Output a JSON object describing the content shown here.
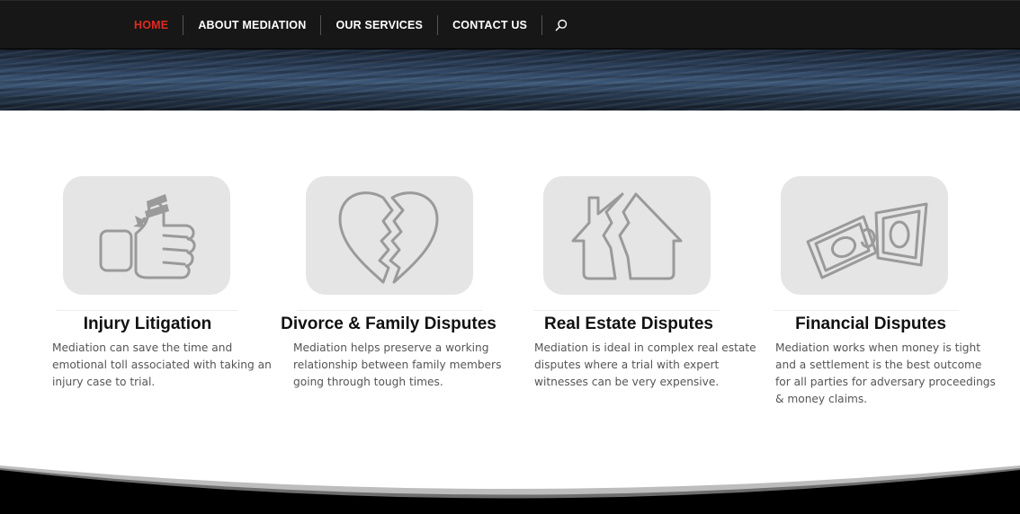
{
  "nav": {
    "items": [
      {
        "label": "HOME",
        "active": true
      },
      {
        "label": "ABOUT MEDIATION",
        "active": false
      },
      {
        "label": "OUR SERVICES",
        "active": false
      },
      {
        "label": "CONTACT US",
        "active": false
      }
    ],
    "search_icon": "search-icon",
    "active_color": "#e02b20"
  },
  "colors": {
    "nav_bg": "#171717",
    "card_bg": "#e5e5e5",
    "icon_stroke": "#9a9a9a",
    "title": "#111111",
    "body_text": "#555555"
  },
  "services": [
    {
      "icon": "bandaged-thumbs-up-icon",
      "title": "Injury Litigation",
      "lines": [
        "Mediation can save the time and",
        "emotional toll associated with taking an",
        "injury case to trial."
      ]
    },
    {
      "icon": "broken-heart-icon",
      "title": "Divorce & Family Disputes",
      "lines": [
        "Mediation helps preserve a working",
        "relationship between family members",
        "going through tough times."
      ]
    },
    {
      "icon": "cracked-house-icon",
      "title": "Real Estate Disputes",
      "lines": [
        "Mediation is ideal in complex real estate",
        "disputes where a trial with expert",
        "witnesses can be very expensive."
      ]
    },
    {
      "icon": "money-bills-icon",
      "title": "Financial Disputes",
      "lines": [
        "Mediation works when money is tight",
        "and a settlement is the best outcome",
        "for all parties for adversary proceedings",
        "& money claims."
      ]
    }
  ]
}
